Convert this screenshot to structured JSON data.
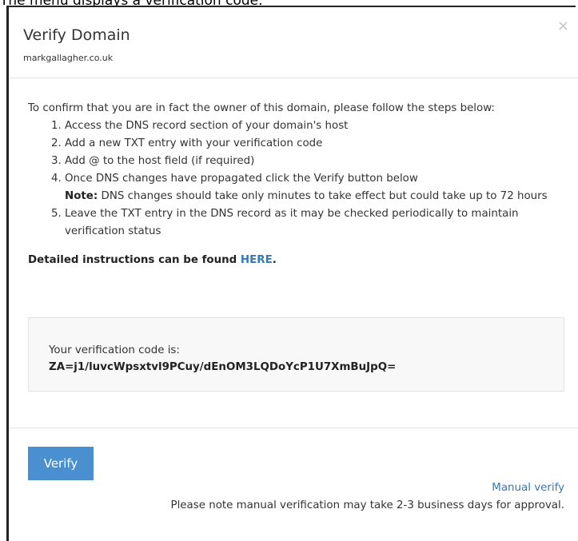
{
  "caption": "The menu displays a verification code.",
  "modal": {
    "title": "Verify Domain",
    "domain": "markgallagher.co.uk",
    "close_icon": "×"
  },
  "instructions": {
    "intro": "To confirm that you are in fact the owner of this domain, please follow the steps below:",
    "steps": [
      "Access the DNS record section of your domain's host",
      "Add a new TXT entry with your verification code",
      "Add @ to the host field (if required)",
      "Once DNS changes have propagated click the Verify button below",
      "Leave the TXT entry in the DNS record as it may be checked periodically to maintain verification status"
    ],
    "note_label": "Note:",
    "note_text": " DNS changes should take only minutes to take effect but could take up to 72 hours",
    "detail_prefix": "Detailed instructions can be found ",
    "detail_link": "HERE",
    "detail_suffix": "."
  },
  "verification": {
    "label": "Your verification code is:",
    "code": "ZA=j1/luvcWpsxtvl9PCuy/dEnOM3LQDoYcP1U7XmBuJpQ="
  },
  "footer": {
    "verify_button": "Verify",
    "manual_verify_link": "Manual verify",
    "manual_note": "Please note manual verification may take 2-3 business days for approval."
  },
  "colors": {
    "primary_button": "#4a8fd0",
    "link": "#337ab7",
    "code_box_background": "#f8f8f8"
  }
}
